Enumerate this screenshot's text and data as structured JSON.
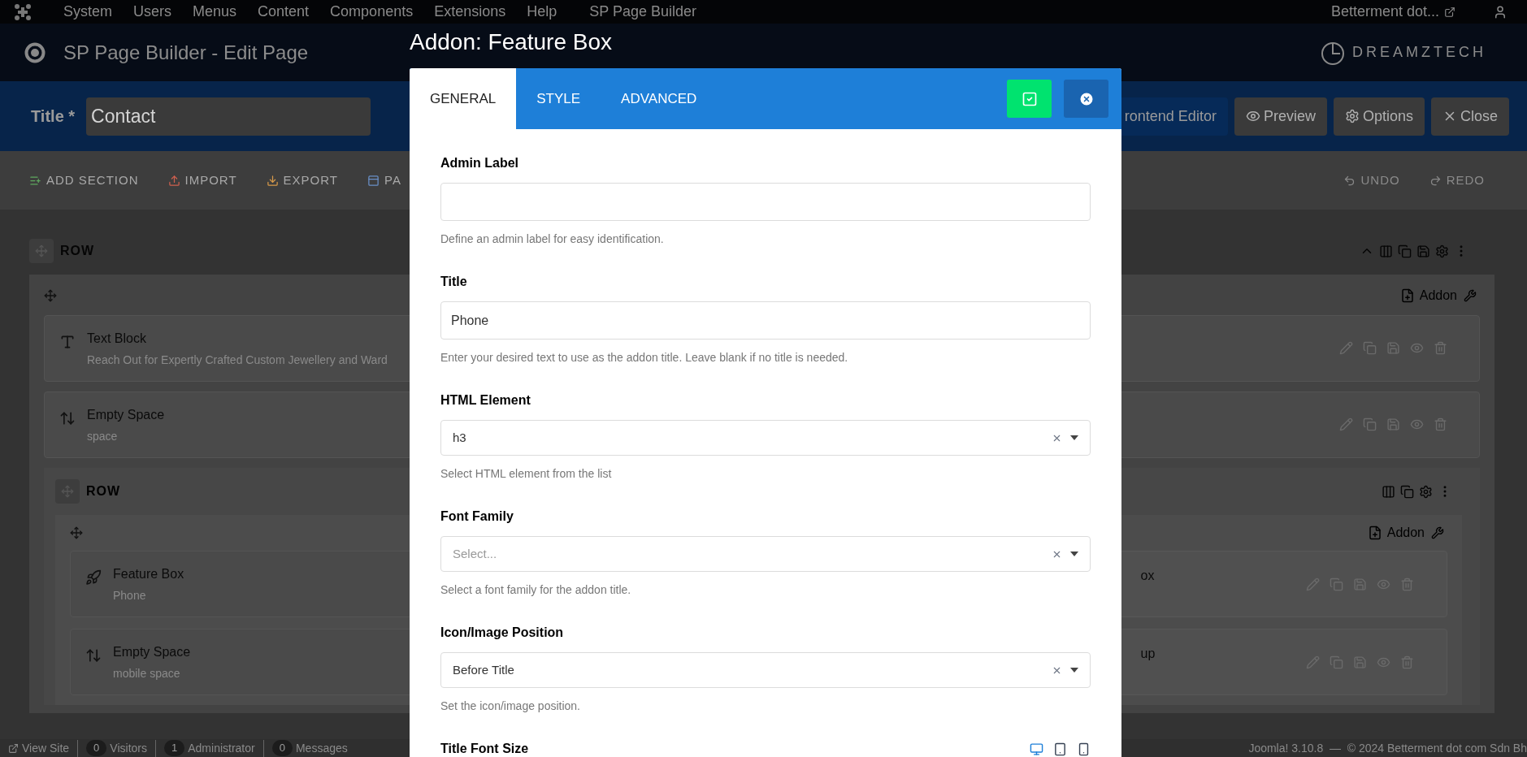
{
  "top_menu": {
    "items": [
      "System",
      "Users",
      "Menus",
      "Content",
      "Components",
      "Extensions",
      "Help",
      "SP Page Builder"
    ],
    "site_link": "Betterment dot..."
  },
  "header": {
    "title": "SP Page Builder - Edit Page",
    "logo_text": "DREAMZTECH"
  },
  "title_bar": {
    "label": "Title *",
    "value": "Contact",
    "buttons": [
      {
        "label": "rontend Editor",
        "kind": "primary"
      },
      {
        "label": "Preview",
        "kind": "preview"
      },
      {
        "label": "Options",
        "kind": "options"
      },
      {
        "label": "Close",
        "kind": "close"
      }
    ]
  },
  "toolbar": {
    "left": [
      {
        "label": "ADD SECTION",
        "kind": "add"
      },
      {
        "label": "IMPORT",
        "kind": "import"
      },
      {
        "label": "EXPORT",
        "kind": "export"
      },
      {
        "label": "PA",
        "kind": "page"
      }
    ],
    "right": [
      {
        "label": "UNDO",
        "kind": "undo"
      },
      {
        "label": "REDO",
        "kind": "redo"
      }
    ]
  },
  "canvas": {
    "row_label": "ROW",
    "addon_button": "Addon",
    "addons": [
      {
        "title": "Text Block",
        "subtitle": "Reach Out for Expertly Crafted Custom Jewellery and Ward",
        "kind": "text"
      },
      {
        "title": "Empty Space",
        "subtitle": "space",
        "kind": "space"
      }
    ],
    "inner_row": {
      "row_label": "ROW",
      "addon_button": "Addon",
      "left_addons": [
        {
          "title": "Feature Box",
          "subtitle": "Phone",
          "kind": "feature"
        },
        {
          "title": "Empty Space",
          "subtitle": "mobile space",
          "kind": "space"
        }
      ],
      "right_addons": [
        {
          "title": "ox"
        },
        {
          "title": "up"
        }
      ]
    }
  },
  "status_bar": {
    "view_site": "View Site",
    "counters": [
      {
        "count": "0",
        "label": "Visitors"
      },
      {
        "count": "1",
        "label": "Administrator"
      },
      {
        "count": "0",
        "label": "Messages"
      }
    ],
    "footer": "Joomla! 3.10.8  —  © 2024 Betterment dot com Sdn Bh"
  },
  "modal": {
    "title": "Addon: Feature Box",
    "tabs": [
      {
        "label": "GENERAL",
        "selected": true
      },
      {
        "label": "STYLE",
        "selected": false
      },
      {
        "label": "ADVANCED",
        "selected": false
      }
    ],
    "fields": [
      {
        "kind": "text",
        "label": "Admin Label",
        "help": "Define an admin label for easy identification."
      },
      {
        "kind": "text",
        "label": "Title",
        "value": "Phone",
        "help": "Enter your desired text to use as the addon title. Leave blank if no title is needed."
      },
      {
        "kind": "select",
        "label": "HTML Element",
        "value": "h3",
        "help": "Select HTML element from the list"
      },
      {
        "kind": "select",
        "label": "Font Family",
        "placeholder": "Select...",
        "help": "Select a font family for the addon title."
      },
      {
        "kind": "select",
        "label": "Icon/Image Position",
        "value": "Before Title",
        "help": "Set the icon/image position."
      },
      {
        "kind": "responsive",
        "label": "Title Font Size",
        "devices": [
          {
            "kind": "desktop",
            "selected": true
          },
          {
            "kind": "tablet",
            "selected": false
          },
          {
            "kind": "mobile",
            "selected": false
          }
        ]
      }
    ]
  }
}
